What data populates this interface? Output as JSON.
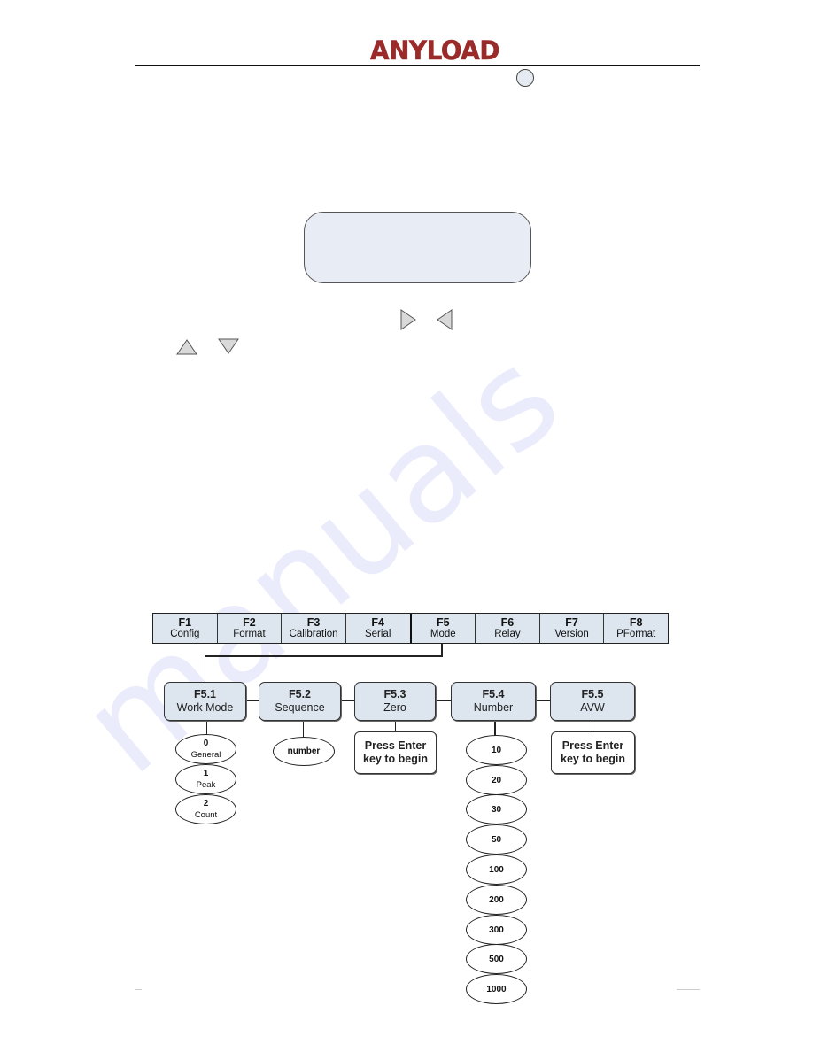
{
  "header": {
    "brand": "ANYLOAD",
    "brand_color": "#9b2b2b"
  },
  "icons": {
    "enter_key": "circle-key-icon",
    "right_arrow": "triangle-right-icon",
    "left_arrow": "triangle-left-icon",
    "up_arrow": "triangle-up-icon",
    "down_arrow": "triangle-down-icon"
  },
  "display": {
    "text": ""
  },
  "menu": {
    "items": [
      {
        "code": "F1",
        "label": "Config"
      },
      {
        "code": "F2",
        "label": "Format"
      },
      {
        "code": "F3",
        "label": "Calibration"
      },
      {
        "code": "F4",
        "label": "Serial"
      },
      {
        "code": "F5",
        "label": "Mode"
      },
      {
        "code": "F6",
        "label": "Relay"
      },
      {
        "code": "F7",
        "label": "Version"
      },
      {
        "code": "F8",
        "label": "PFormat"
      }
    ],
    "selected": "F5"
  },
  "submenu": {
    "items": [
      {
        "code": "F5.1",
        "label": "Work Mode"
      },
      {
        "code": "F5.2",
        "label": "Sequence"
      },
      {
        "code": "F5.3",
        "label": "Zero"
      },
      {
        "code": "F5.4",
        "label": "Number"
      },
      {
        "code": "F5.5",
        "label": "AVW"
      }
    ]
  },
  "options": {
    "work_mode": [
      {
        "value": "0",
        "label": "General"
      },
      {
        "value": "1",
        "label": "Peak"
      },
      {
        "value": "2",
        "label": "Count"
      }
    ],
    "sequence": [
      "number"
    ],
    "zero_note": [
      "Press Enter",
      "key to begin"
    ],
    "number": [
      "10",
      "20",
      "30",
      "50",
      "100",
      "200",
      "300",
      "500",
      "1000"
    ],
    "avw_note": [
      "Press Enter",
      "key to begin"
    ]
  },
  "colors": {
    "box_fill": "#dde6ef",
    "display_fill": "#e8ecf5",
    "arrow_fill": "#d9d9d9"
  }
}
